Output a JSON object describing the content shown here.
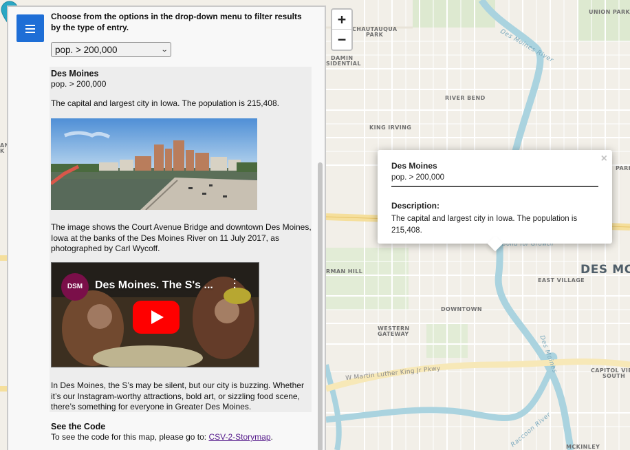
{
  "sidebar": {
    "menu_icon": "hamburger-icon",
    "intro": "Choose from the options in the drop-down menu to filter results by the type of entry.",
    "filter": {
      "selected": "pop. > 200,000"
    },
    "entry": {
      "title": "Des Moines",
      "subtitle": "pop. > 200,000",
      "description": "The capital and largest city in Iowa. The population is 215,408.",
      "photo_caption": "The image shows the Court Avenue Bridge and downtown Des Moines, Iowa at the banks of the Des Moines River on 11 July 2017, as photographed by Carl Wycoff.",
      "video_title": "Des Moines. The S's ...",
      "video_logo": "DSM",
      "blurb": "In Des Moines, the S’s may be silent, but our city is buzzing. Whether it’s our Instagram-worthy attractions, bold art, or sizzling food scene, there’s something for everyone in Greater Des Moines."
    },
    "see_code": {
      "heading": "See the Code",
      "text": "To see the code for this map, please go to: ",
      "link": "CSV-2-Storymap",
      "after": "."
    }
  },
  "zoom": {
    "in": "+",
    "out": "−"
  },
  "popup": {
    "close": "×",
    "title": "Des Moines",
    "subtitle": "pop. > 200,000",
    "desc_heading": "Description:",
    "desc": "The capital and largest city in Iowa. The population is 215,408."
  },
  "map_labels": {
    "union_park": "UNION PARK",
    "chautauqua": "CHAUTAUQUA",
    "chautauqua2": "PARK",
    "mcadamin1": "DAMIN",
    "mcadamin2": "SIDENTIAL",
    "river_bend": "RIVER BEND",
    "king_irving": "KING IRVING",
    "park_right": "PARK",
    "an_left": "AN",
    "k_left": "K",
    "des_moines_big": "DES MO",
    "east_village": "EAST VILLAGE",
    "sherman_hill": "RMAN HILL",
    "downtown": "DOWNTOWN",
    "western_gateway1": "WESTERN",
    "western_gateway2": "GATEWAY",
    "capitol_view1": "CAPITOL VIE",
    "capitol_view2": "SOUTH",
    "mckinley": "MCKINLEY",
    "mlk": "W Martin Luther King Jr Pkwy",
    "des_moines_river": "Des Moines River",
    "des_moines_river2": "Des Moines River",
    "raccoon_river": "Raccoon River",
    "des_moines_river3": "Des Moines",
    "bond_for_growth": "Bond for Growth"
  },
  "colors": {
    "map_bg": "#f2efe8",
    "road": "#ffffff",
    "highway": "#f5df9c",
    "river": "#aad3df",
    "park": "#d6e8c8",
    "marker": "#2aa7c4",
    "menu_button": "#1e6ed6"
  }
}
